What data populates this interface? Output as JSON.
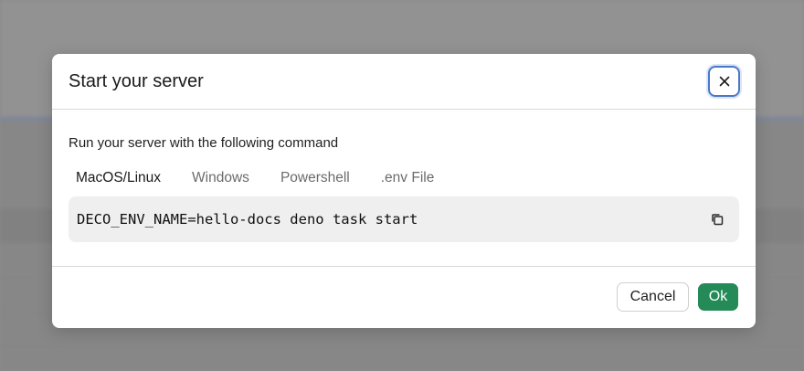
{
  "modal": {
    "title": "Start your server",
    "instruction": "Run your server with the following command",
    "tabs": [
      {
        "label": "MacOS/Linux",
        "active": true
      },
      {
        "label": "Windows",
        "active": false
      },
      {
        "label": "Powershell",
        "active": false
      },
      {
        "label": ".env File",
        "active": false
      }
    ],
    "command": "DECO_ENV_NAME=hello-docs deno task start",
    "cancel_label": "Cancel",
    "ok_label": "Ok"
  },
  "icons": {
    "close": "close-icon",
    "copy": "copy-icon"
  },
  "colors": {
    "ok_button": "#248a58",
    "focus_ring": "#4a78c9",
    "code_background": "#efefef"
  }
}
